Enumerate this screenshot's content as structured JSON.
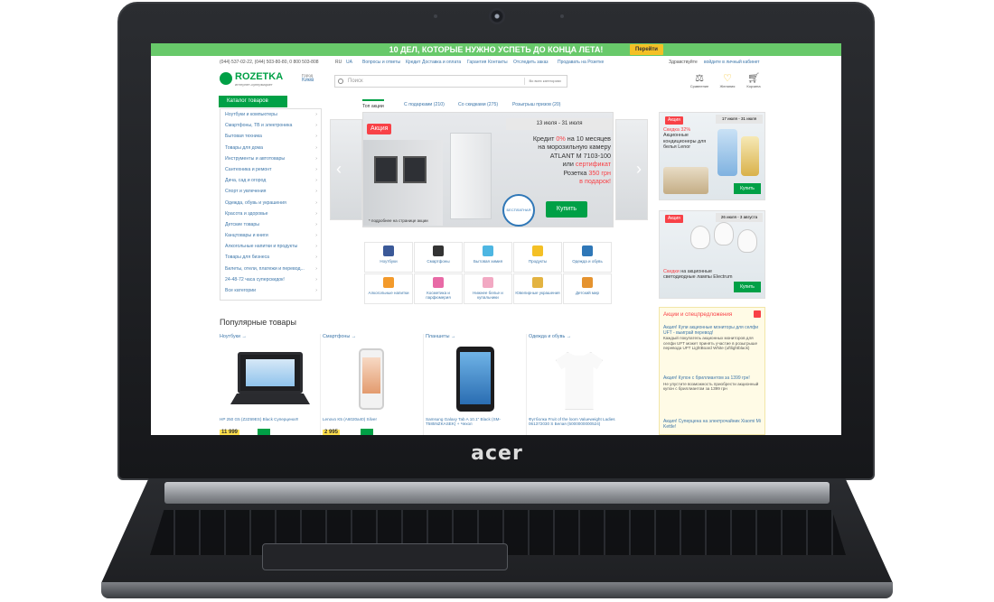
{
  "laptop": {
    "brand": "acer"
  },
  "promo_banner": {
    "text": "10 ДЕЛ, КОТОРЫЕ НУЖНО УСПЕТЬ ДО КОНЦА ЛЕТА!",
    "button": "Перейти"
  },
  "topbar": {
    "phones": "(044) 537-02-22, (044) 503-80-80, 0 800 503-808",
    "lang_ru": "RU",
    "lang_ua": "UA",
    "links": [
      "Вопросы и ответы",
      "Кредит",
      "Доставка и оплата",
      "Гарантия",
      "Контакты"
    ],
    "track": "Отследить заказ",
    "sell": "Продавать на Розетке",
    "greeting": "Здравствуйте",
    "login": "войдите в личный кабинет"
  },
  "header": {
    "logo": "ROZETKA",
    "tagline": "интернет-супермаркет",
    "city_label": "Город",
    "city": "Киев",
    "search_placeholder": "Поиск",
    "category_select": "Во всех категориях",
    "compare": "Сравнение",
    "wishlist": "Желания",
    "cart": "Корзина"
  },
  "catalog": {
    "button": "Каталог товаров",
    "items": [
      "Ноутбуки и компьютеры",
      "Смартфоны, ТВ и электроника",
      "Бытовая техника",
      "Товары для дома",
      "Инструменты и автотовары",
      "Сантехника и ремонт",
      "Дача, сад и огород",
      "Спорт и увлечения",
      "Одежда, обувь и украшения",
      "Красота и здоровье",
      "Детские товары",
      "Канцтовары и книги",
      "Алкогольные напитки и продукты",
      "Товары для бизнеса",
      "Билеты, отели, платежи и перевод...",
      "24-48-72 часа суперскидок!",
      "Все категории"
    ]
  },
  "tabs": [
    "Топ акции",
    "С подарками (210)",
    "Со скидками (275)",
    "Розыгрыш призов (20)"
  ],
  "slider": {
    "badge": "Акция",
    "dates": "13 июля - 31 июля",
    "line1_prefix": "Кредит",
    "line1_red": "0%",
    "line1_suffix": "на 10 месяцев",
    "line2": "на морозильную камеру",
    "line3": "ATLANT M 7103-100",
    "line4_prefix": "или",
    "line4_red": "сертификат",
    "line5_prefix": "Розетка",
    "line5_red": "350 грн",
    "line6_red": "в подарок!",
    "buy": "Купить",
    "delivery_badge": "БЕСПЛАТНАЯ ДОСТАВКА",
    "note": "* подробнее на странице акции"
  },
  "categories": [
    {
      "label": "Ноутбуки",
      "color": "#3b5998"
    },
    {
      "label": "Смартфоны",
      "color": "#333333"
    },
    {
      "label": "Бытовая химия",
      "color": "#4db6e2"
    },
    {
      "label": "Продукты",
      "color": "#f4c025"
    },
    {
      "label": "Одежда и обувь",
      "color": "#2f77b7"
    },
    {
      "label": "Алкогольные напитки",
      "color": "#f39a2b"
    },
    {
      "label": "Косметика и парфюмерия",
      "color": "#e86aa6"
    },
    {
      "label": "Нижнее белье и купальники",
      "color": "#f2a9c3"
    },
    {
      "label": "Ювелирные украшения",
      "color": "#e3b341"
    },
    {
      "label": "Детский мир",
      "color": "#e5932f"
    }
  ],
  "right_promos": [
    {
      "badge": "Акция",
      "dates": "17 июля - 31 июля",
      "red": "Скидка 32%",
      "text": "Акционные кондиционеры для белья Lenor",
      "buy": "Купить"
    },
    {
      "badge": "Акция",
      "dates": "26 июля - 3 августа",
      "red": "Скидки",
      "text": "на акционные светодиодные лампы Electrum",
      "buy": "Купить"
    }
  ],
  "popular": {
    "title": "Популярные товары",
    "columns": [
      {
        "category": "Ноутбуки →",
        "name": "HP 250 G5 (Z2Z69ES) Black Суперцена!!!",
        "price": "11 999"
      },
      {
        "category": "Смартфоны →",
        "name": "Lenovo K5 (A6020a40) Silver",
        "price": "2 995"
      },
      {
        "category": "Планшеты →",
        "name": "Samsung Galaxy Tab A 10.1\" Black (SM-T585NZKASEK) + Чехол",
        "price": ""
      },
      {
        "category": "Одежда и обувь →",
        "name": "Футболка Fruit of the loom Valueweight Ladies 061372030 S Белая (5000000000524)",
        "price": ""
      }
    ]
  },
  "promo_panel": {
    "title": "Акции и спецпредложения",
    "entries": [
      {
        "title": "Акция! Купи акционные мониторы для селфи UFT - выиграй перевод!",
        "text": "Каждый покупатель акционных мониторов для селфи UFT может принять участие в розыгрыше перевода UFT LightBoard White (uftlightblack)"
      },
      {
        "title": "Акция! Купон с бриллиантом за 1399 грн!",
        "text": "Не упустите возможность приобрести акционный купон с бриллиантом за 1399 грн"
      },
      {
        "title": "Акция! Суперцена на электрочайник Xiaomi Mi Kettle!",
        "text": ""
      }
    ]
  }
}
